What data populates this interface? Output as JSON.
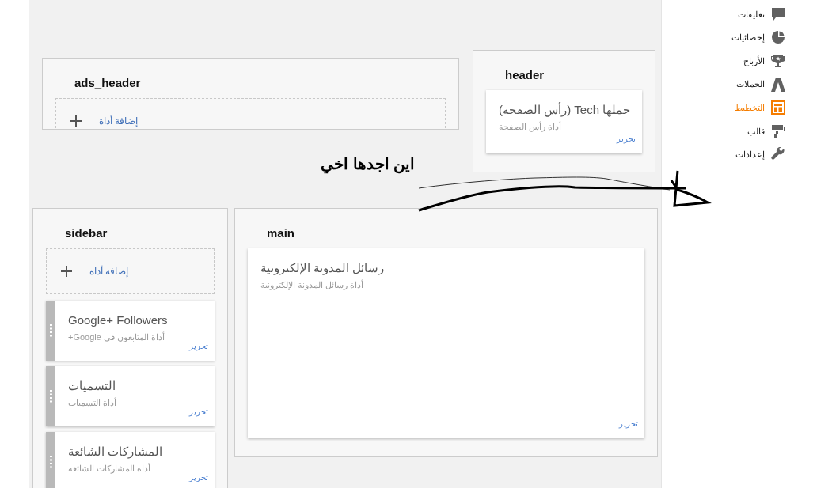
{
  "nav": [
    {
      "label": "تعليقات",
      "kind": "comment",
      "selected": false
    },
    {
      "label": "إحصائيات",
      "kind": "stats",
      "selected": false
    },
    {
      "label": "الأرباح",
      "kind": "trophy",
      "selected": false
    },
    {
      "label": "الحملات",
      "kind": "campaign",
      "selected": false
    },
    {
      "label": "التخطيط",
      "kind": "layout",
      "selected": true
    },
    {
      "label": "قالب",
      "kind": "template",
      "selected": false
    },
    {
      "label": "إعدادات",
      "kind": "settings",
      "selected": false
    }
  ],
  "sections": [
    {
      "title": "header",
      "widgets": [
        {
          "title": "حملها Tech (رأس الصفحة)",
          "subtitle": "أداة رأس الصفحة",
          "edit": "تحرير",
          "draggable": false
        }
      ]
    },
    {
      "title": "ads_header",
      "add_widget": "إضافة أداة"
    },
    {
      "title": "main",
      "widgets": [
        {
          "title": "رسائل المدونة الإلكترونية",
          "subtitle": "أداة رسائل المدونة الإلكترونية",
          "edit": "تحرير",
          "draggable": false
        }
      ]
    },
    {
      "title": "sidebar",
      "add_widget": "إضافة أداة",
      "widgets": [
        {
          "title": "Google+ Followers",
          "subtitle": "أداة المتابعون في Google+",
          "edit": "تحرير",
          "draggable": true
        },
        {
          "title": "التسميات",
          "subtitle": "أداة التسميات",
          "edit": "تحرير",
          "draggable": true
        },
        {
          "title": "المشاركات الشائعة",
          "subtitle": "أداة المشاركات الشائعة",
          "edit": "تحرير",
          "draggable": true
        }
      ]
    }
  ],
  "annotation": {
    "note": "اين اجدها اخي"
  }
}
